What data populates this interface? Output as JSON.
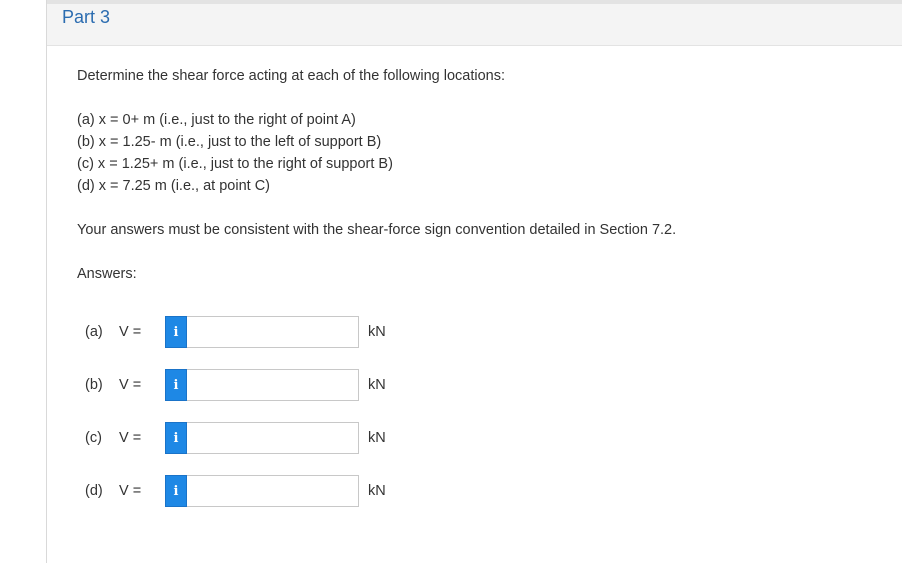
{
  "part": {
    "title": "Part 3"
  },
  "question": {
    "prompt": "Determine the shear force acting at each of the following locations:",
    "locations": [
      "(a) x = 0+ m (i.e., just to the right of point A)",
      "(b) x = 1.25- m (i.e., just to the left of support B)",
      "(c) x = 1.25+ m (i.e., just to the right of support B)",
      "(d) x = 7.25 m (i.e., at point C)"
    ],
    "convention": "Your answers must be consistent with the shear-force sign convention detailed in Section 7.2.",
    "answers_label": "Answers:"
  },
  "answers": [
    {
      "letter": "(a)",
      "var": "V =",
      "info": "i",
      "value": "",
      "unit": "kN"
    },
    {
      "letter": "(b)",
      "var": "V =",
      "info": "i",
      "value": "",
      "unit": "kN"
    },
    {
      "letter": "(c)",
      "var": "V =",
      "info": "i",
      "value": "",
      "unit": "kN"
    },
    {
      "letter": "(d)",
      "var": "V =",
      "info": "i",
      "value": "",
      "unit": "kN"
    }
  ],
  "colors": {
    "link_blue": "#2b6cb0",
    "info_blue": "#1e88e5"
  }
}
